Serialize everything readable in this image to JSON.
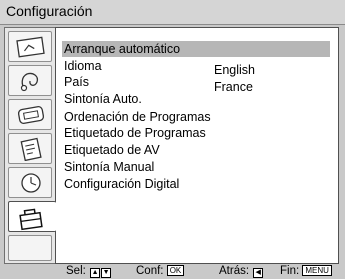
{
  "window": {
    "title": "Configuración"
  },
  "sidebar": {
    "tabs": [
      {
        "icon": "picture-icon",
        "active": false
      },
      {
        "icon": "sound-icon",
        "active": false
      },
      {
        "icon": "screen-icon",
        "active": false
      },
      {
        "icon": "features-icon",
        "active": false
      },
      {
        "icon": "timer-icon",
        "active": false
      },
      {
        "icon": "toolbox-icon",
        "active": true
      }
    ]
  },
  "menu": {
    "items": [
      {
        "label": "Arranque automático",
        "selected": true
      },
      {
        "label": "Idioma",
        "value": "English"
      },
      {
        "label": "País",
        "value": "France"
      },
      {
        "label": "Sintonía Auto."
      },
      {
        "label": "Ordenación de Programas"
      },
      {
        "label": "Etiquetado de Programas"
      },
      {
        "label": "Etiquetado de AV"
      },
      {
        "label": "Sintonía Manual"
      },
      {
        "label": "Configuración Digital"
      }
    ]
  },
  "footer": {
    "sel_label": "Sel:",
    "conf_label": "Conf:",
    "conf_key": "OK",
    "back_label": "Atrás:",
    "exit_label": "Fin:",
    "exit_key": "MENU"
  },
  "colors": {
    "frame": "#c9c9c9",
    "highlight": "#b6b6b6",
    "panel": "#ffffff"
  }
}
